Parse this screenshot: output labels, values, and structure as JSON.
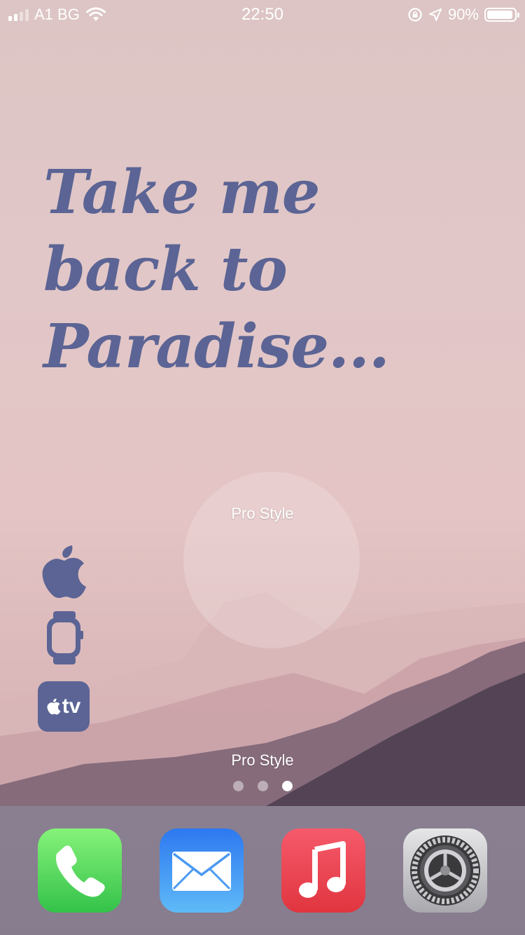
{
  "status_bar": {
    "carrier": "A1 BG",
    "time": "22:50",
    "battery_percent": "90%",
    "signal_bars": 2,
    "battery_level": 0.9
  },
  "wallpaper": {
    "quote_lines": [
      "Take me",
      "back to",
      "Paradise..."
    ],
    "quote_color": "#5b6494"
  },
  "widgets": {
    "label_top": "Pro Style",
    "label_bottom": "Pro Style"
  },
  "side_icons": [
    {
      "icon": "apple-icon"
    },
    {
      "icon": "watch-icon"
    },
    {
      "icon": "tv-icon",
      "label": "tv"
    }
  ],
  "page_indicator": {
    "pages": 3,
    "current": 3
  },
  "dock": {
    "apps": [
      {
        "icon": "phone-icon",
        "color": "#4cd964"
      },
      {
        "icon": "mail-icon",
        "color": "#2f8ef7"
      },
      {
        "icon": "music-icon",
        "color": "#f0445c"
      },
      {
        "icon": "settings-icon",
        "color": "#8e8e93"
      }
    ]
  }
}
